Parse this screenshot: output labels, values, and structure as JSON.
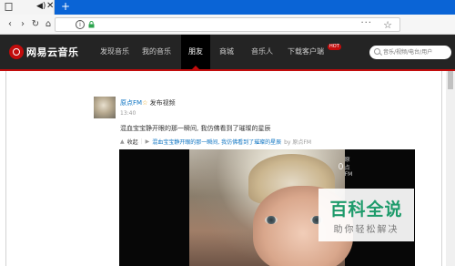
{
  "browser": {
    "tab_close": "✕",
    "new_tab": "+",
    "menu_dots": "···",
    "bookmark_star": "☆",
    "info_symbol": "i",
    "back_symbol": "‹",
    "forward_symbol": "›",
    "reload_symbol": "↻",
    "home_symbol": "⌂",
    "speaker_symbol": "◀)"
  },
  "nav": {
    "logo_text": "网易云音乐",
    "items": [
      "发现音乐",
      "我的音乐",
      "朋友",
      "商城",
      "音乐人",
      "下载客户端"
    ],
    "active_index": 2,
    "hot_badge": "HOT",
    "search_placeholder": "音乐/视频/电台/用户"
  },
  "post": {
    "user_name": "原点FM",
    "vip_star": "☆",
    "action": "发布视频",
    "time": "13:40",
    "text": "混血宝宝静开眼的那一瞬间, 我仿佛看到了璀璨的星辰",
    "collect_label": "收起",
    "video_title": "混血宝宝静开眼的那一瞬间, 我仿佛看到了璀璨的星辰",
    "video_source": "by 原点FM",
    "watermark": "原点FM"
  },
  "overlay": {
    "big_text": "百科全说",
    "small_text": "助你轻松解决"
  },
  "colors": {
    "nav_bg": "#242424",
    "accent_red": "#c20c0c",
    "link_blue": "#0c73c2",
    "tab_blue": "#0a64d6",
    "badge_green": "#1e9b6b"
  }
}
